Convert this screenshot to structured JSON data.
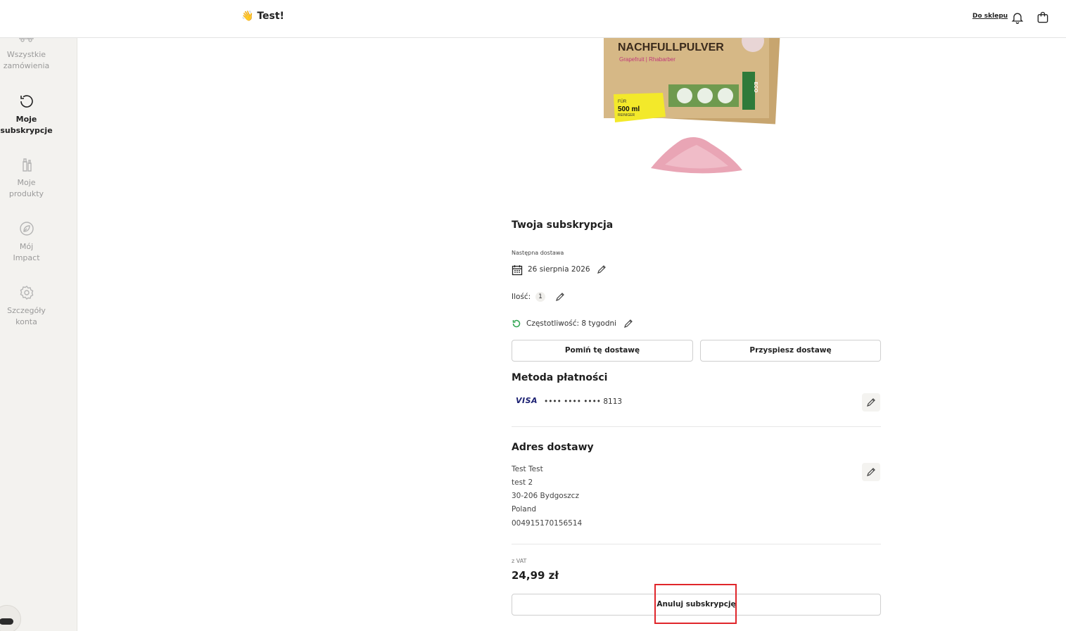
{
  "header": {
    "greeting_emoji": "👋",
    "greeting": "Test!",
    "shop_link": "Do sklepu"
  },
  "sidebar": {
    "items": [
      {
        "label": "Wszystkie\nzamówienia",
        "icon": "truck-icon"
      },
      {
        "label": "Moje\nsubskrypcje",
        "icon": "refresh-icon"
      },
      {
        "label": "Moje\nprodukty",
        "icon": "bottles-icon"
      },
      {
        "label": "Mój\nImpact",
        "icon": "leaf-icon"
      },
      {
        "label": "Szczegóły\nkonta",
        "icon": "gear-icon"
      }
    ]
  },
  "product": {
    "pack_text": "NACHFULLPULVER",
    "pack_sub": "Grapefruit | Rhabarber",
    "pack_badge_line1": "FÜR",
    "pack_badge_line2": "500 ml",
    "pack_badge_line3": "REINIGER",
    "pack_side": "ECO"
  },
  "subscription": {
    "title": "Twoja subskrypcja",
    "next_delivery_label": "Następna dostawa",
    "next_delivery_date": "26 sierpnia 2026",
    "quantity_label": "Ilość:",
    "quantity_value": "1",
    "frequency": "Częstotliwość: 8 tygodni",
    "skip_button": "Pomiń tę dostawę",
    "expedite_button": "Przyspiesz dostawę"
  },
  "payment": {
    "title": "Metoda płatności",
    "card_brand": "VISA",
    "card_number": "•••• •••• •••• 8113"
  },
  "address": {
    "title": "Adres dostawy",
    "lines": [
      "Test Test",
      "test 2",
      "30-206 Bydgoszcz",
      "Poland",
      "004915170156514"
    ]
  },
  "pricing": {
    "vat_label": "z VAT",
    "price": "24,99 zł"
  },
  "cancel_button": "Anuluj subskrypcję",
  "colors": {
    "accent_green": "#2ea44f",
    "highlight_red": "#e0262b",
    "sidebar_bg": "#f3f2ef"
  }
}
